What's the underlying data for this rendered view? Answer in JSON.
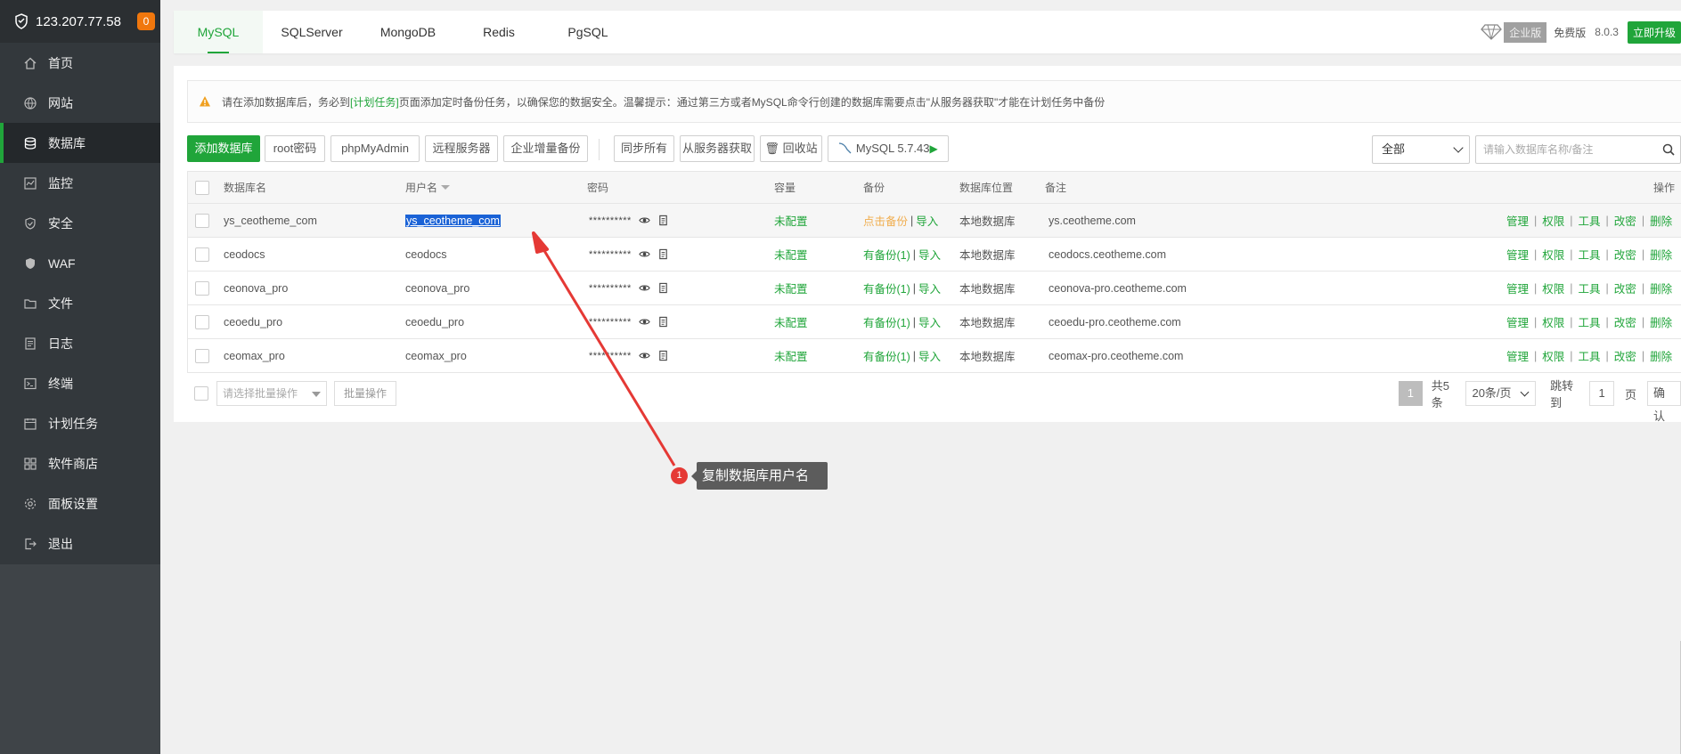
{
  "server": {
    "ip": "123.207.77.58",
    "badge": "0"
  },
  "sidebar": {
    "items": [
      {
        "label": "首页",
        "icon": "home-icon"
      },
      {
        "label": "网站",
        "icon": "globe-icon"
      },
      {
        "label": "数据库",
        "icon": "database-icon",
        "active": true
      },
      {
        "label": "监控",
        "icon": "monitor-icon"
      },
      {
        "label": "安全",
        "icon": "shield-check-icon"
      },
      {
        "label": "WAF",
        "icon": "waf-shield-icon"
      },
      {
        "label": "文件",
        "icon": "folder-icon"
      },
      {
        "label": "日志",
        "icon": "log-icon"
      },
      {
        "label": "终端",
        "icon": "terminal-icon"
      },
      {
        "label": "计划任务",
        "icon": "calendar-icon"
      },
      {
        "label": "软件商店",
        "icon": "apps-icon"
      },
      {
        "label": "面板设置",
        "icon": "settings-icon"
      },
      {
        "label": "退出",
        "icon": "logout-icon"
      }
    ]
  },
  "tabs": [
    "MySQL",
    "SQLServer",
    "MongoDB",
    "Redis",
    "PgSQL"
  ],
  "topright": {
    "edition": "企业版",
    "free": "免费版",
    "version": "8.0.3",
    "upgrade": "立即升级"
  },
  "notice": {
    "pre": "请在添加数据库后，务必到",
    "link": "[计划任务]",
    "post": "页面添加定时备份任务，以确保您的数据安全。温馨提示：通过第三方或者MySQL命令行创建的数据库需要点击\"从服务器获取\"才能在计划任务中备份"
  },
  "toolbar": {
    "add_db": "添加数据库",
    "root_pw": "root密码",
    "phpmyadmin": "phpMyAdmin",
    "remote": "远程服务器",
    "incremental": "企业增量备份",
    "sync_all": "同步所有",
    "fetch": "从服务器获取",
    "recycle": "回收站",
    "mysql_version": "MySQL 5.7.43",
    "filter": "全部",
    "search_placeholder": "请输入数据库名称/备注"
  },
  "table": {
    "headers": {
      "name": "数据库名",
      "user": "用户名",
      "password": "密码",
      "capacity": "容量",
      "backup": "备份",
      "location": "数据库位置",
      "remark": "备注",
      "ops": "操作"
    },
    "rows": [
      {
        "name": "ys_ceotheme_com",
        "user": "ys_ceotheme_com",
        "password": "**********",
        "capacity": "未配置",
        "backup": "点击备份",
        "import": "导入",
        "location": "本地数据库",
        "remark": "ys.ceotheme.com"
      },
      {
        "name": "ceodocs",
        "user": "ceodocs",
        "password": "**********",
        "capacity": "未配置",
        "backup": "有备份(1)",
        "import": "导入",
        "location": "本地数据库",
        "remark": "ceodocs.ceotheme.com"
      },
      {
        "name": "ceonova_pro",
        "user": "ceonova_pro",
        "password": "**********",
        "capacity": "未配置",
        "backup": "有备份(1)",
        "import": "导入",
        "location": "本地数据库",
        "remark": "ceonova-pro.ceotheme.com"
      },
      {
        "name": "ceoedu_pro",
        "user": "ceoedu_pro",
        "password": "**********",
        "capacity": "未配置",
        "backup": "有备份(1)",
        "import": "导入",
        "location": "本地数据库",
        "remark": "ceoedu-pro.ceotheme.com"
      },
      {
        "name": "ceomax_pro",
        "user": "ceomax_pro",
        "password": "**********",
        "capacity": "未配置",
        "backup": "有备份(1)",
        "import": "导入",
        "location": "本地数据库",
        "remark": "ceomax-pro.ceotheme.com"
      }
    ],
    "ops": [
      "管理",
      "权限",
      "工具",
      "改密",
      "删除"
    ]
  },
  "footer": {
    "batch_placeholder": "请选择批量操作",
    "batch_button": "批量操作",
    "page": "1",
    "total": "共5条",
    "per_page": "20条/页",
    "jump_label": "跳转到",
    "jump_value": "1",
    "page_unit": "页",
    "confirm": "确认"
  },
  "annotation": {
    "number": "1",
    "text": "复制数据库用户名"
  },
  "colors": {
    "accent": "#20a53a",
    "sidebar": "#3f4448",
    "warning": "#f0ad4e",
    "annotation_arrow": "#e53935",
    "selection": "#1a62d6"
  }
}
